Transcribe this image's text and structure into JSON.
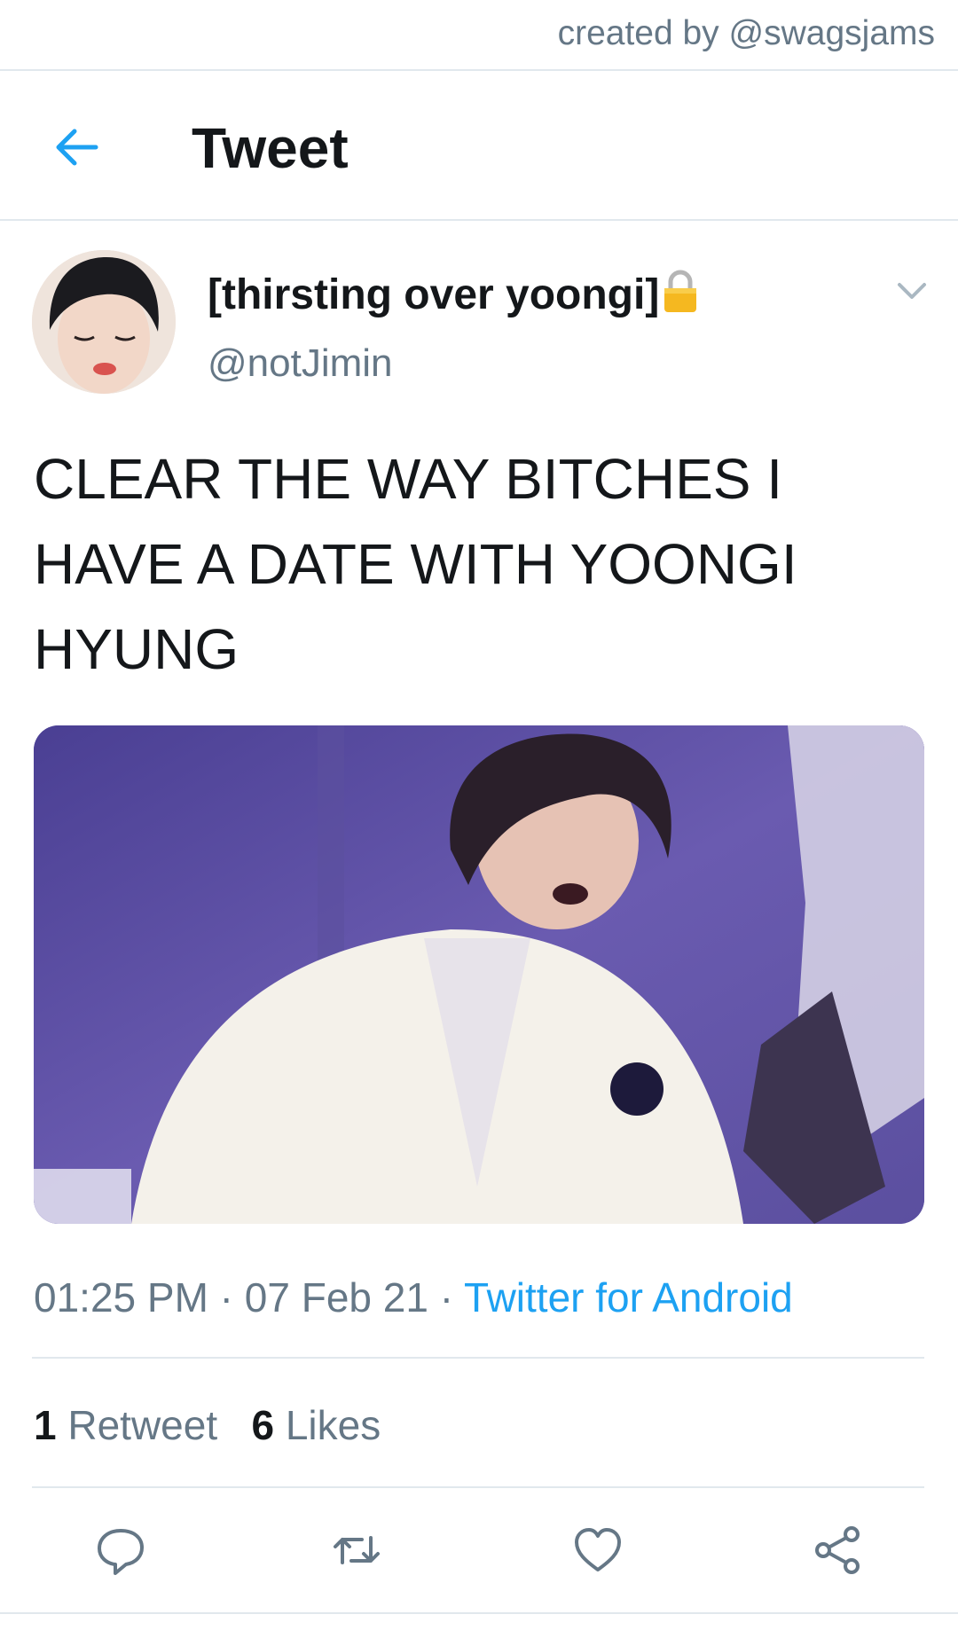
{
  "credit": "created by @swagsjams",
  "appbar": {
    "title": "Tweet"
  },
  "tweet": {
    "display_name": "[thirsting over yoongi]",
    "handle": "@notJimin",
    "text_lines": [
      "CLEAR THE WAY BITCHES I",
      "HAVE A DATE WITH YOONGI",
      "HYUNG"
    ],
    "time": "01:25 PM",
    "date": "07 Feb 21",
    "source": "Twitter for Android",
    "dot": " · ",
    "retweets": {
      "count": "1",
      "label": "Retweet"
    },
    "likes": {
      "count": "6",
      "label": "Likes"
    }
  },
  "icons": {
    "back": "back-arrow-icon",
    "lock": "lock-icon",
    "caret": "chevron-down-icon",
    "reply": "reply-icon",
    "retweet": "retweet-icon",
    "like": "heart-icon",
    "share": "share-icon"
  },
  "colors": {
    "accent": "#1da1f2",
    "secondary_text": "#657786",
    "primary_text": "#14171a",
    "divider": "#e1e8ed"
  }
}
